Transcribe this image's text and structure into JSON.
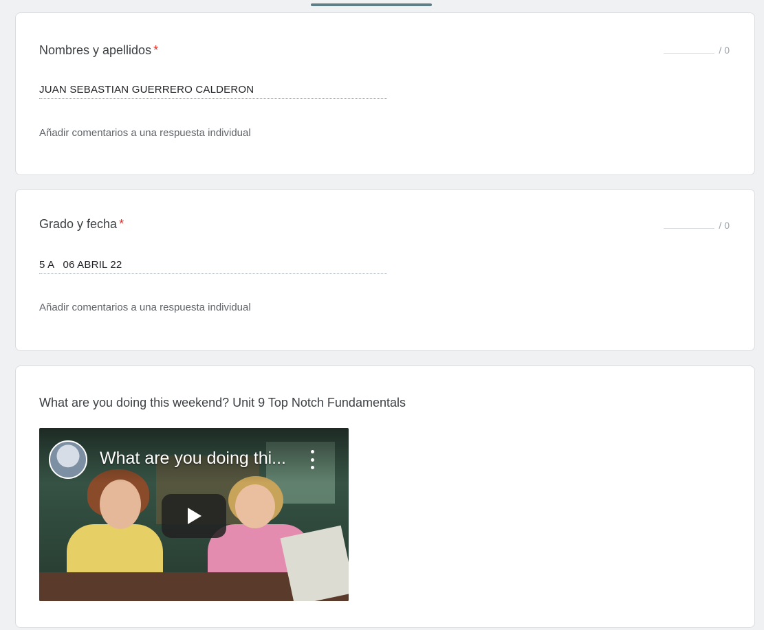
{
  "form": {
    "questions": [
      {
        "title": "Nombres y apellidos",
        "required_mark": "*",
        "points": "/ 0",
        "answer": "JUAN SEBASTIAN GUERRERO CALDERON",
        "comment_link": "Añadir comentarios a una respuesta individual"
      },
      {
        "title": "Grado y fecha",
        "required_mark": "*",
        "points": "/ 0",
        "answer": "5 A   06 ABRIL 22",
        "comment_link": "Añadir comentarios a una respuesta individual"
      }
    ],
    "video_section": {
      "title": "What are you doing this weekend? Unit 9 Top Notch Fundamentals",
      "video_title": "What are you doing thi...",
      "icons": [
        "channel-avatar",
        "more-vert-icon",
        "play-icon"
      ]
    }
  },
  "colors": {
    "required": "#d93025",
    "background": "#f0f1f3",
    "card": "#ffffff",
    "tab_indicator": "#5f7f88"
  }
}
